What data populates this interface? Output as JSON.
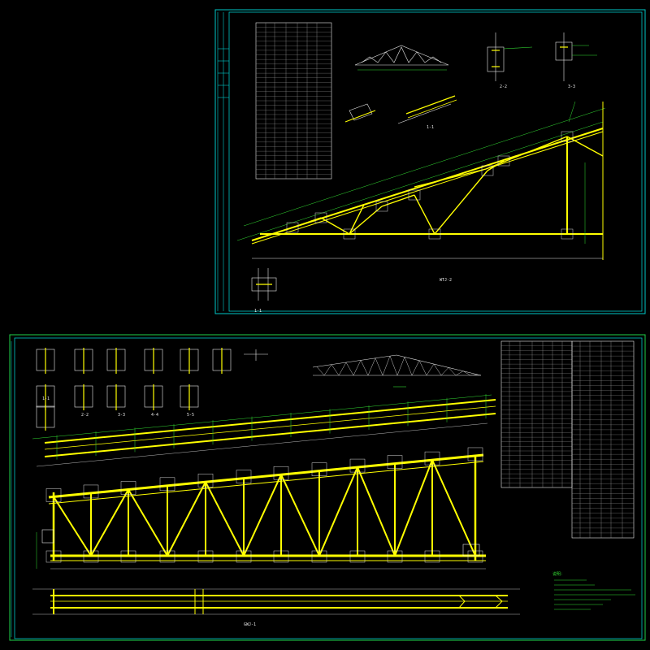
{
  "colors": {
    "background": "#000000",
    "frame": "#00c8c8",
    "frame_lower": "#1fd24a",
    "member": "#ffff00",
    "dimension": "#33dd33",
    "text": "#e8e8e8",
    "plate": "#d8d8d8"
  },
  "sheet_top": {
    "label_main": "WTJ-2",
    "label_section_a": "1-1",
    "label_section_b": "2-2",
    "label_section_c": "3-3",
    "label_section_d": "1-1"
  },
  "sheet_bottom": {
    "label_main": "GWJ-1",
    "label_sections": [
      "1-1",
      "2-2",
      "3-3",
      "4-4",
      "5-5"
    ],
    "notes_title": "说明："
  }
}
